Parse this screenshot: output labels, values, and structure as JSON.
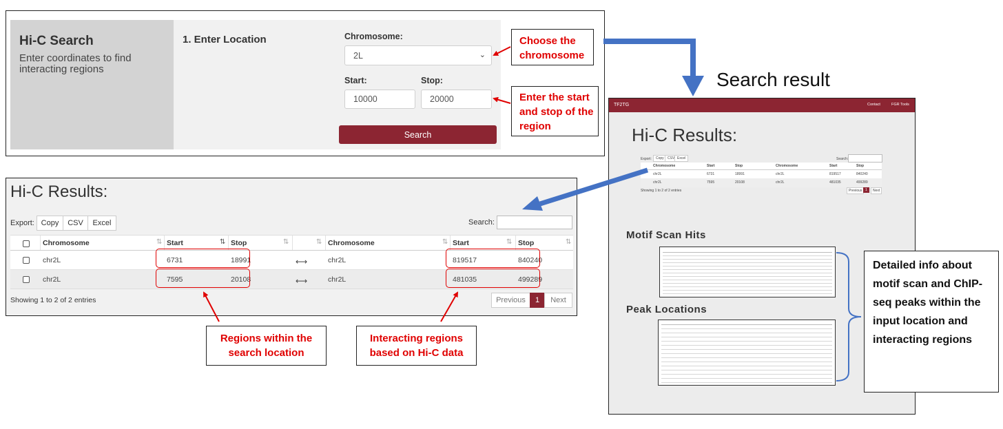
{
  "search_form": {
    "panel_title": "Hi-C Search",
    "panel_subtitle": "Enter coordinates to find interacting regions",
    "step_title": "1. Enter Location",
    "chromosome_label": "Chromosome:",
    "chromosome_value": "2L",
    "start_label": "Start:",
    "start_value": "10000",
    "stop_label": "Stop:",
    "stop_value": "20000",
    "search_button": "Search"
  },
  "annotations": {
    "choose_chromosome": "Choose the chromosome",
    "enter_start_stop": "Enter the start and stop of the region",
    "search_result": "Search result",
    "regions_within": "Regions within the search location",
    "interacting_regions": "Interacting regions based on Hi-C data",
    "detailed_info": "Detailed info about motif scan and ChIP-seq peaks within the input location and interacting regions"
  },
  "results": {
    "title": "Hi-C Results:",
    "export_label": "Export:",
    "export_buttons": [
      "Copy",
      "CSV",
      "Excel"
    ],
    "search_label": "Search:",
    "columns": [
      "Chromosome",
      "Start",
      "Stop",
      "Chromosome",
      "Start",
      "Stop"
    ],
    "rows": [
      {
        "chr1": "chr2L",
        "start1": "6731",
        "stop1": "18991",
        "link": "⟷",
        "chr2": "chr2L",
        "start2": "819517",
        "stop2": "840240"
      },
      {
        "chr1": "chr2L",
        "start1": "7595",
        "stop1": "20108",
        "link": "⟷",
        "chr2": "chr2L",
        "start2": "481035",
        "stop2": "499289"
      }
    ],
    "showing": "Showing 1 to 2 of 2 entries",
    "pagination": {
      "previous": "Previous",
      "current": "1",
      "next": "Next"
    }
  },
  "mini_page": {
    "brand": "TF2TG",
    "nav_contact": "Contact",
    "nav_tools": "FGR Tools",
    "title": "Hi-C Results:",
    "export_label": "Export:",
    "export_buttons": [
      "Copy",
      "CSV",
      "Excel"
    ],
    "search_label": "Search:",
    "columns": [
      "Chromosome",
      "Start",
      "Stop",
      "Chromosome",
      "Start",
      "Stop"
    ],
    "rows": [
      [
        "chr2L",
        "6731",
        "18991",
        "chr2L",
        "819517",
        "840240"
      ],
      [
        "chr2L",
        "7595",
        "20108",
        "chr2L",
        "481035",
        "499289"
      ]
    ],
    "showing": "Showing 1 to 2 of 2 entries",
    "pagination": [
      "Previous",
      "1",
      "Next"
    ],
    "motif_heading": "Motif Scan Hits",
    "peak_heading": "Peak Locations"
  },
  "colors": {
    "brand_red": "#8c2532",
    "annotation_red": "#e00000",
    "arrow_blue": "#4472c4"
  },
  "icons": {
    "select_chevron": "chevron-down-icon",
    "row_link": "bidirectional-arrow-icon",
    "sort": "sort-icon"
  }
}
